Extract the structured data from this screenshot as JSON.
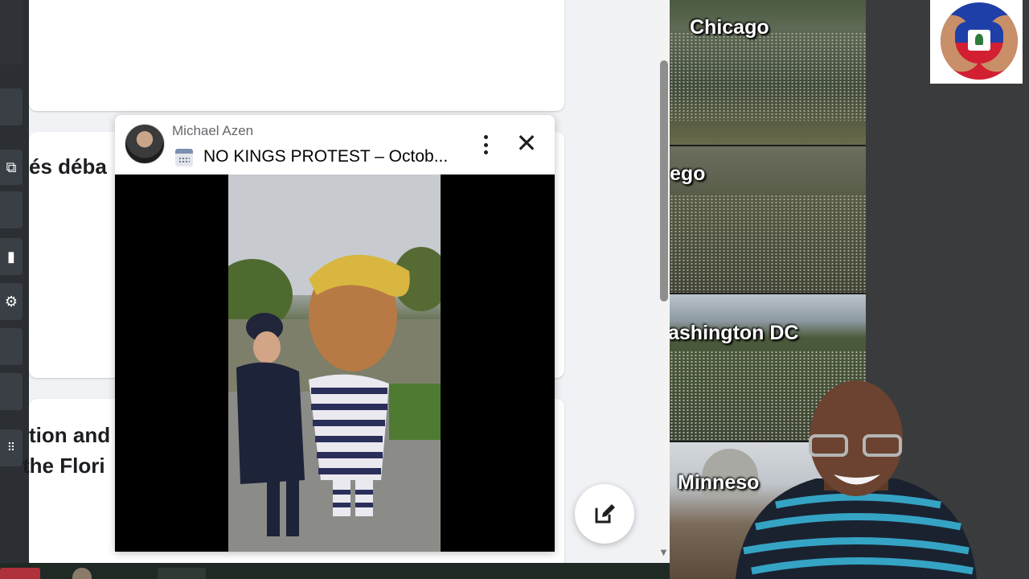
{
  "popup": {
    "author": "Michael Azen",
    "title": "NO KINGS PROTEST – Octob..."
  },
  "feed": {
    "card1_snippet": "és déba",
    "card2_line1": "tion and",
    "card2_line2": "the Flori"
  },
  "collage": {
    "labels": [
      "Chicago",
      "ego",
      "ashington DC",
      "Minneso"
    ]
  },
  "colors": {
    "accent_blue": "#1877f2",
    "feed_bg": "#f0f2f5",
    "flag_blue": "#1f3fa8",
    "flag_red": "#d21f32"
  },
  "icons": [
    "calendar-icon",
    "more-options-icon",
    "close-icon",
    "edit-icon"
  ]
}
